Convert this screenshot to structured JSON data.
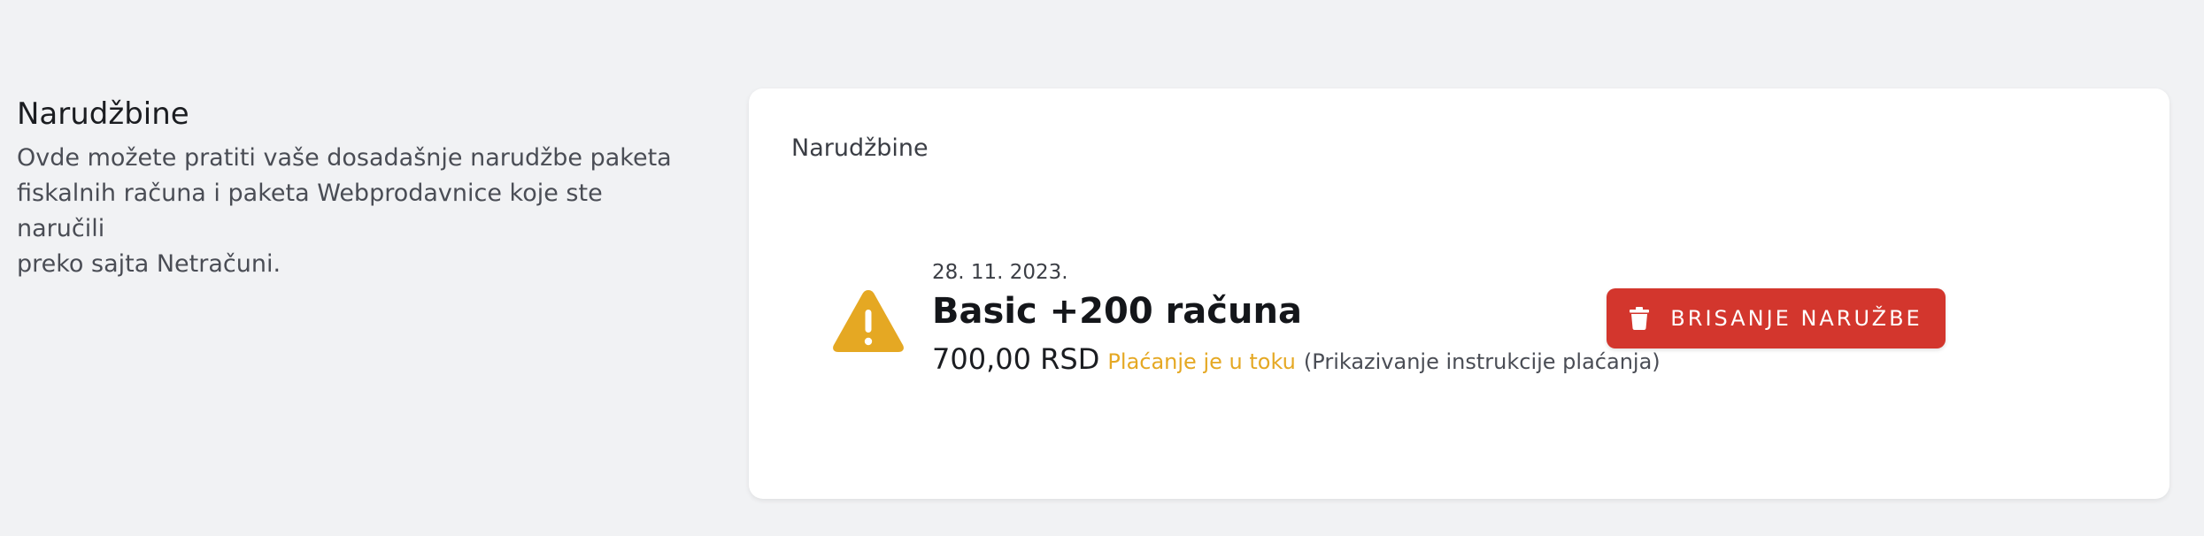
{
  "intro": {
    "title": "Narudžbine",
    "description_line1": "Ovde možete pratiti vaše dosadašnje narudžbe paketa",
    "description_line2": "fiskalnih računa i paketa Webprodavnice koje ste naručili",
    "description_line3": "preko sajta Netračuni."
  },
  "card": {
    "title": "Narudžbine"
  },
  "order": {
    "date": "28. 11. 2023.",
    "name": "Basic +200 računa",
    "price": "700,00 RSD",
    "status": "Plaćanje je u toku",
    "instructions_link": "(Prikazivanje instrukcije plaćanja)",
    "icon": "warning-icon",
    "delete_label": "BRISANJE NARUŽBE",
    "delete_icon": "trash-icon"
  },
  "colors": {
    "background": "#f1f2f4",
    "card": "#ffffff",
    "warning": "#e5a823",
    "danger": "#d3362d"
  }
}
